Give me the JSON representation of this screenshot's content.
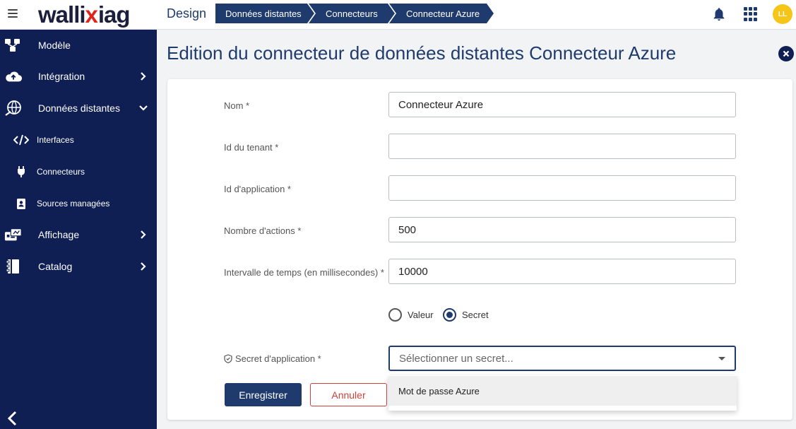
{
  "header": {
    "logo_main": "walli",
    "logo_x": "x",
    "logo_suffix": "iag",
    "app_title": "Design",
    "breadcrumbs": [
      "Données distantes",
      "Connecteurs",
      "Connecteur Azure"
    ],
    "avatar_initials": "LL",
    "icons": {
      "menu": "hamburger-icon",
      "notifications": "bell-icon",
      "apps": "apps-grid-icon"
    }
  },
  "sidebar": {
    "items": [
      {
        "label": "Modèle",
        "icon": "model-icon"
      },
      {
        "label": "Intégration",
        "icon": "cloud-upload-icon"
      },
      {
        "label": "Données distantes",
        "icon": "globe-icon"
      },
      {
        "label": "Interfaces",
        "icon": "code-icon"
      },
      {
        "label": "Connecteurs",
        "icon": "plug-icon"
      },
      {
        "label": "Sources managées",
        "icon": "contact-book-icon"
      },
      {
        "label": "Affichage",
        "icon": "display-icon"
      },
      {
        "label": "Catalog",
        "icon": "catalog-icon"
      }
    ]
  },
  "main": {
    "title": "Edition du connecteur de données distantes Connecteur Azure",
    "form": {
      "name_label": "Nom *",
      "name_value": "Connecteur Azure",
      "tenant_label": "Id du tenant *",
      "tenant_value": "",
      "app_id_label": "Id d'application *",
      "app_id_value": "",
      "actions_label": "Nombre d'actions *",
      "actions_value": "500",
      "interval_label": "Intervalle de temps (en millisecondes) *",
      "interval_value": "10000",
      "radio_value_label": "Valeur",
      "radio_secret_label": "Secret",
      "selected_radio": "Secret",
      "secret_label": "Secret d'application *",
      "secret_placeholder": "Sélectionner un secret...",
      "secret_options": [
        "Mot de passe Azure"
      ]
    },
    "buttons": {
      "save": "Enregistrer",
      "cancel": "Annuler"
    }
  },
  "colors": {
    "primary": "#1f3b6e",
    "sidebar": "#0f1f53",
    "cancel": "#d0413c",
    "avatar": "#f5c518",
    "logo_accent": "#e2231a"
  }
}
